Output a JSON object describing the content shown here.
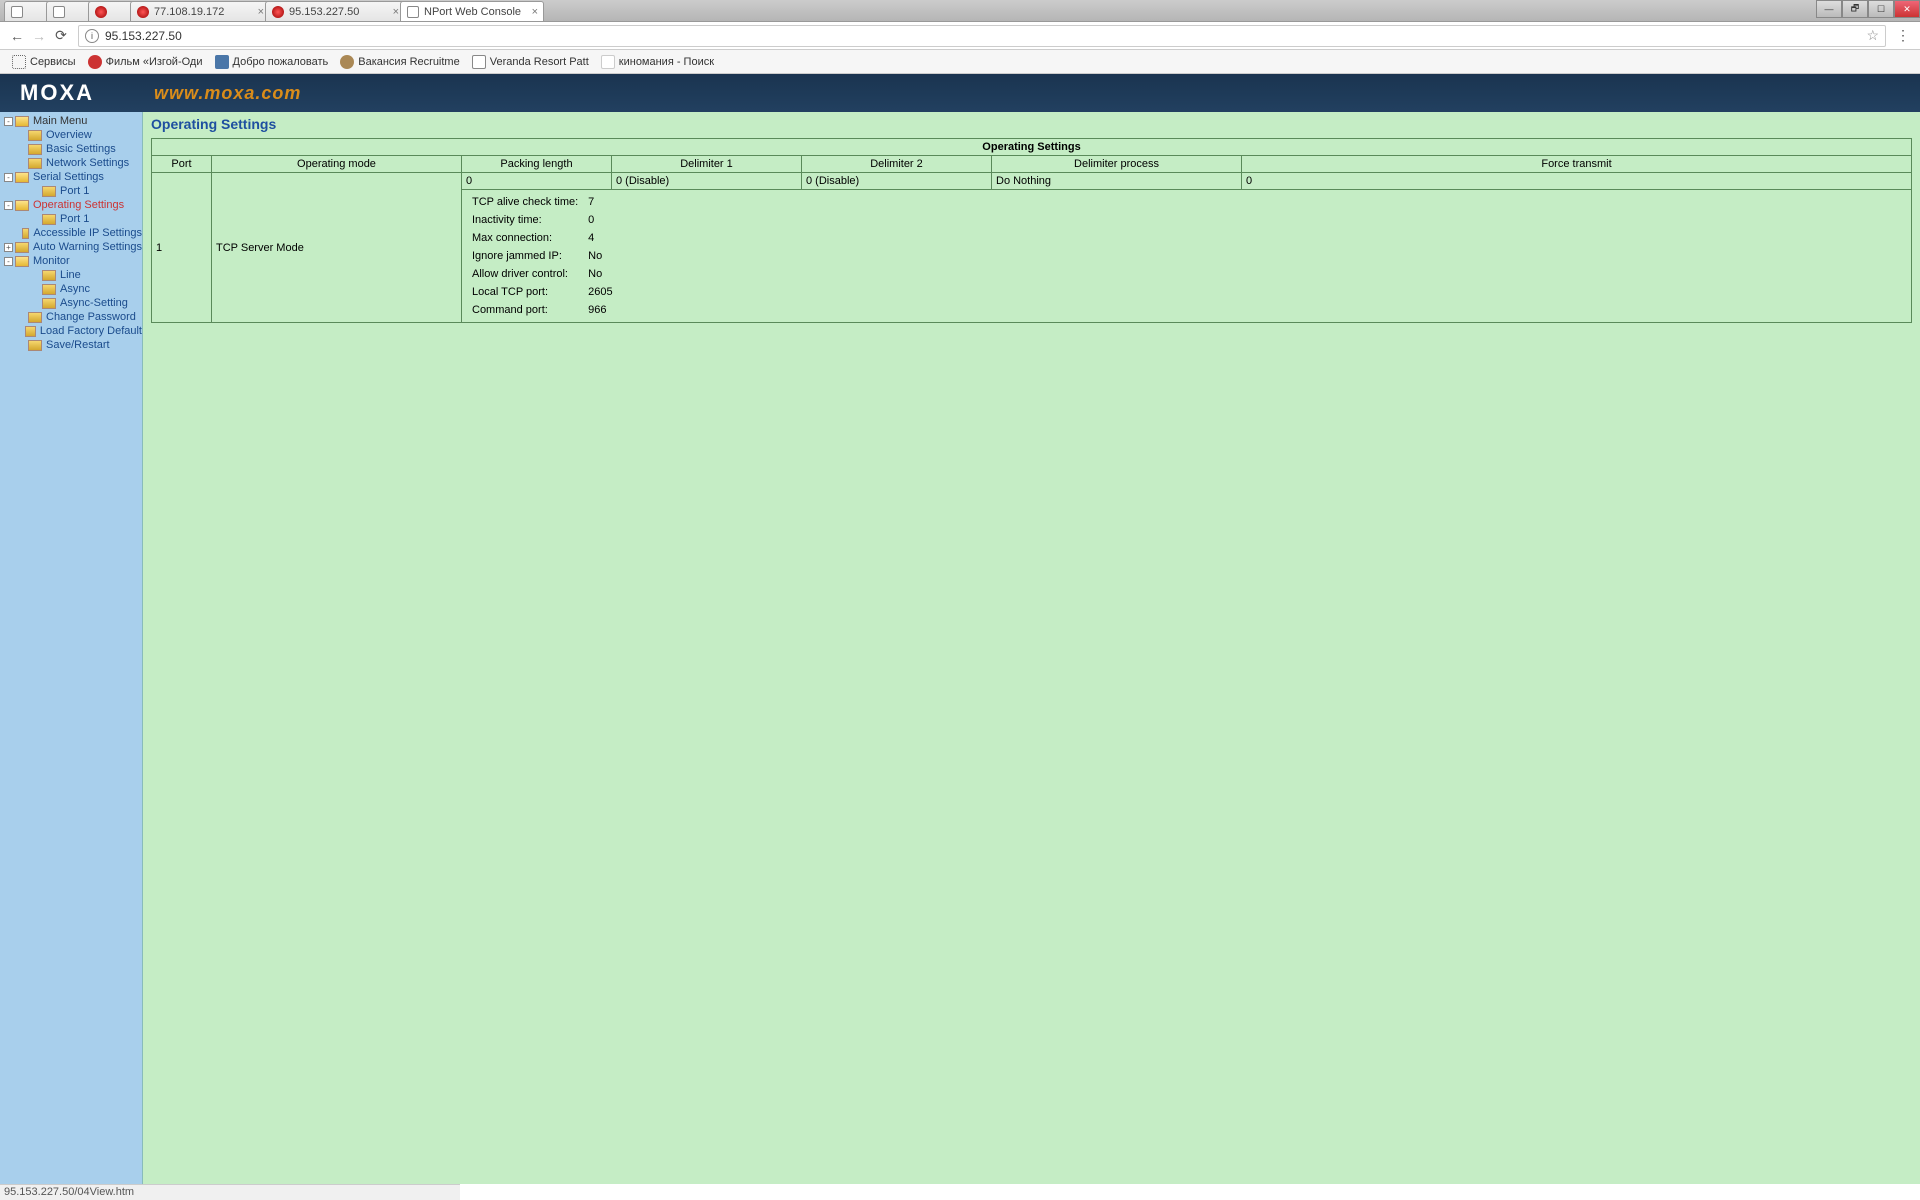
{
  "window": {
    "min": "—",
    "max": "☐",
    "close": "✕",
    "restore": "🗗"
  },
  "tabs": [
    {
      "label": "",
      "wide": false,
      "icon": "doc"
    },
    {
      "label": "",
      "wide": false,
      "icon": "doc"
    },
    {
      "label": "",
      "wide": false,
      "icon": "red"
    },
    {
      "label": "77.108.19.172",
      "wide": true,
      "icon": "red",
      "closable": true
    },
    {
      "label": "95.153.227.50",
      "wide": true,
      "icon": "red",
      "closable": true
    },
    {
      "label": "NPort Web Console",
      "wide": true,
      "icon": "doc",
      "closable": true,
      "active": true
    }
  ],
  "addr": {
    "url": "95.153.227.50"
  },
  "bookmarks": [
    {
      "label": "Сервисы",
      "cls": "bm-apps"
    },
    {
      "label": "Фильм «Изгой-Оди",
      "cls": "bm-red"
    },
    {
      "label": "Добро пожаловать",
      "cls": "bm-blue"
    },
    {
      "label": "Вакансия Recruitme",
      "cls": "bm-brown"
    },
    {
      "label": "Veranda Resort Patt",
      "cls": "bm-m"
    },
    {
      "label": "киномания - Поиск",
      "cls": "bm-g"
    }
  ],
  "banner": {
    "logo": "MOXA",
    "url": "www.moxa.com"
  },
  "tree": {
    "main": "Main Menu",
    "overview": "Overview",
    "basic": "Basic Settings",
    "network": "Network Settings",
    "serial": "Serial Settings",
    "serial_port1": "Port 1",
    "operating": "Operating Settings",
    "operating_port1": "Port 1",
    "accessible": "Accessible IP Settings",
    "autowarn": "Auto Warning Settings",
    "monitor": "Monitor",
    "monitor_line": "Line",
    "monitor_async": "Async",
    "monitor_async_setting": "Async-Setting",
    "changepw": "Change Password",
    "factory": "Load Factory Default",
    "save": "Save/Restart"
  },
  "content": {
    "title": "Operating Settings",
    "table_caption": "Operating Settings",
    "headers": {
      "port": "Port",
      "mode": "Operating mode",
      "packing": "Packing length",
      "delim1": "Delimiter 1",
      "delim2": "Delimiter 2",
      "delimproc": "Delimiter process",
      "force": "Force transmit"
    },
    "row": {
      "port": "1",
      "mode": "TCP Server Mode",
      "packing": "0",
      "delim1": "0 (Disable)",
      "delim2": "0 (Disable)",
      "delimproc": "Do Nothing",
      "force": "0"
    },
    "details": {
      "tcp_alive_label": "TCP alive check time:",
      "tcp_alive": "7",
      "inactivity_label": "Inactivity time:",
      "inactivity": "0",
      "maxconn_label": "Max connection:",
      "maxconn": "4",
      "ignore_label": "Ignore jammed IP:",
      "ignore": "No",
      "allow_label": "Allow driver control:",
      "allow": "No",
      "localport_label": "Local TCP port:",
      "localport": "2605",
      "cmdport_label": "Command port:",
      "cmdport": "966"
    }
  },
  "status": "95.153.227.50/04View.htm"
}
